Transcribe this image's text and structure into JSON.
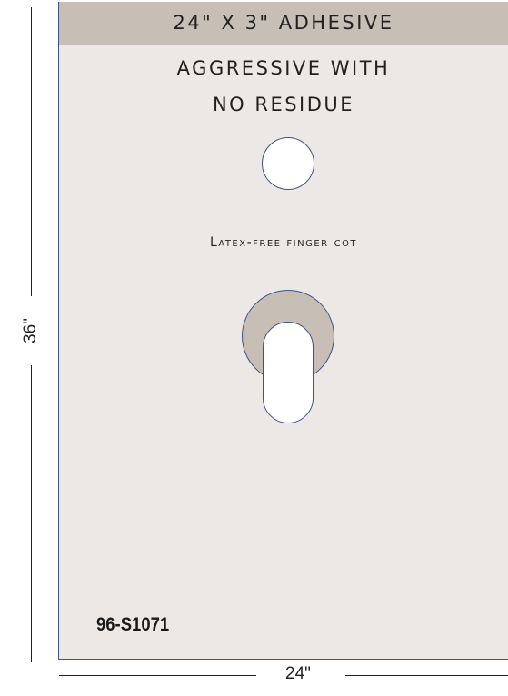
{
  "sign": {
    "band_text": "24\" X 3\" ADHESIVE",
    "line1": "AGGRESSIVE WITH",
    "line2": "NO RESIDUE",
    "cot_label": "Latex-free finger cot",
    "part_number": "96-S1071"
  },
  "dimensions": {
    "height": "36\"",
    "width": "24\""
  },
  "colors": {
    "panel": "#ece8e5",
    "adhesive_band": "#c7beb5",
    "outline": "#3e5288",
    "text": "#231f20"
  }
}
